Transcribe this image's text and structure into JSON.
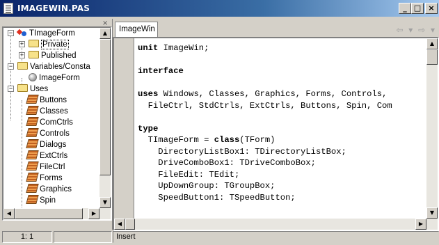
{
  "window": {
    "title": "IMAGEWIN.PAS",
    "minimize": "_",
    "maximize": "□",
    "close": "×"
  },
  "explorer": {
    "close_glyph": "×",
    "tree": [
      {
        "label": "TImageForm",
        "expander": "−",
        "icon": "class-icon"
      },
      {
        "label": "Private",
        "expander": "+",
        "icon": "folder-icon",
        "selected": true
      },
      {
        "label": "Published",
        "expander": "+",
        "icon": "folder-icon"
      },
      {
        "label": "Variables/Consta",
        "expander": "−",
        "icon": "folder-icon"
      },
      {
        "label": "ImageForm",
        "icon": "variable-icon"
      },
      {
        "label": "Uses",
        "expander": "−",
        "icon": "folder-icon"
      },
      {
        "label": "Buttons",
        "icon": "unit-icon"
      },
      {
        "label": "Classes",
        "icon": "unit-icon"
      },
      {
        "label": "ComCtrls",
        "icon": "unit-icon"
      },
      {
        "label": "Controls",
        "icon": "unit-icon"
      },
      {
        "label": "Dialogs",
        "icon": "unit-icon"
      },
      {
        "label": "ExtCtrls",
        "icon": "unit-icon"
      },
      {
        "label": "FileCtrl",
        "icon": "unit-icon"
      },
      {
        "label": "Forms",
        "icon": "unit-icon"
      },
      {
        "label": "Graphics",
        "icon": "unit-icon"
      },
      {
        "label": "Spin",
        "icon": "unit-icon"
      }
    ]
  },
  "editor": {
    "tab_label": "ImageWin",
    "nav_back": "⇦",
    "nav_forward": "⇨",
    "code_lines": [
      {
        "kw": "unit",
        "rest": " ImageWin;"
      },
      {
        "kw": "",
        "rest": ""
      },
      {
        "kw": "interface",
        "rest": ""
      },
      {
        "kw": "",
        "rest": ""
      },
      {
        "kw": "uses",
        "rest": " Windows, Classes, Graphics, Forms, Controls,"
      },
      {
        "kw": "",
        "rest": "  FileCtrl, StdCtrls, ExtCtrls, Buttons, Spin, Com"
      },
      {
        "kw": "",
        "rest": ""
      },
      {
        "kw": "type",
        "rest": ""
      },
      {
        "kw": "",
        "rest": "  TImageForm = ",
        "kw2": "class",
        "rest2": "(TForm)"
      },
      {
        "kw": "",
        "rest": "    DirectoryListBox1: TDirectoryListBox;"
      },
      {
        "kw": "",
        "rest": "    DriveComboBox1: TDriveComboBox;"
      },
      {
        "kw": "",
        "rest": "    FileEdit: TEdit;"
      },
      {
        "kw": "",
        "rest": "    UpDownGroup: TGroupBox;"
      },
      {
        "kw": "",
        "rest": "    SpeedButton1: TSpeedButton;"
      }
    ]
  },
  "status": {
    "position": "1:   1",
    "mode": "Insert"
  },
  "colors": {
    "titlebar_start": "#0a246a",
    "titlebar_end": "#a6caf0",
    "chrome": "#d4d0c8"
  }
}
